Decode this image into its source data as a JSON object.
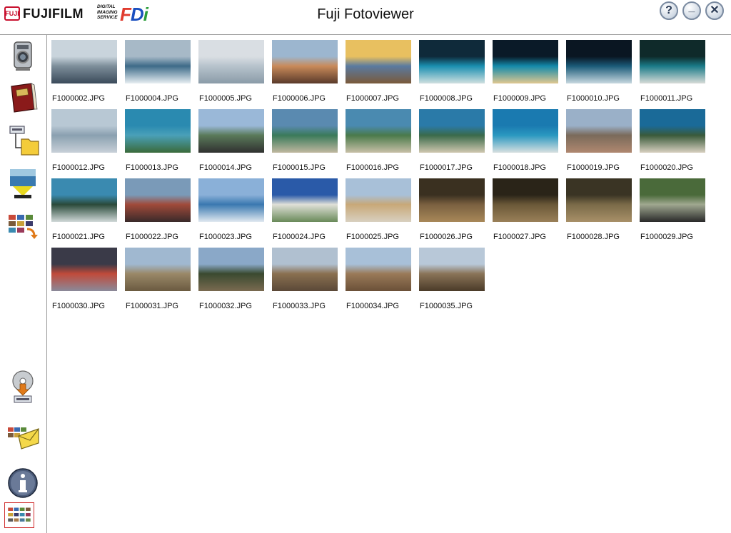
{
  "header": {
    "brand": "FUJIFILM",
    "brand_mark": "FUJI",
    "service_lines": [
      "DIGITAL",
      "IMAGING",
      "SERVICE"
    ],
    "service_logo": "FDi",
    "title": "Fuji Fotoviewer"
  },
  "window_buttons": {
    "help": "?",
    "minimize": "_",
    "close": "✕"
  },
  "sidebar": {
    "items": [
      {
        "name": "camera-icon"
      },
      {
        "name": "photo-album-icon"
      },
      {
        "name": "export-to-folder-icon"
      },
      {
        "name": "slideshow-projector-icon"
      },
      {
        "name": "rotate-images-icon"
      },
      {
        "name": "cd-download-icon"
      },
      {
        "name": "email-images-icon"
      },
      {
        "name": "info-icon"
      },
      {
        "name": "thumbnail-view-icon"
      }
    ]
  },
  "photos": [
    {
      "file": "F1000002.JPG",
      "colors": [
        "#c9d4dc",
        "#7d8e9a",
        "#3a4a5a"
      ]
    },
    {
      "file": "F1000004.JPG",
      "colors": [
        "#a7b9c7",
        "#3d6a88",
        "#e8eef2"
      ]
    },
    {
      "file": "F1000005.JPG",
      "colors": [
        "#d9dee3",
        "#b7c3cc",
        "#8a9ba8"
      ]
    },
    {
      "file": "F1000006.JPG",
      "colors": [
        "#9cb6cf",
        "#c98a5a",
        "#5a3a2a"
      ]
    },
    {
      "file": "F1000007.JPG",
      "colors": [
        "#e8c060",
        "#5a7aa0",
        "#7a5a3a"
      ]
    },
    {
      "file": "F1000008.JPG",
      "colors": [
        "#0f2a3a",
        "#1a8fb0",
        "#d0e0e0"
      ]
    },
    {
      "file": "F1000009.JPG",
      "colors": [
        "#0a1a28",
        "#138aaa",
        "#e0c890"
      ]
    },
    {
      "file": "F1000010.JPG",
      "colors": [
        "#0a1622",
        "#1a5a78",
        "#c8d8e0"
      ]
    },
    {
      "file": "F1000011.JPG",
      "colors": [
        "#0f2a2a",
        "#1a7a88",
        "#d8dcd8"
      ]
    },
    {
      "file": "F1000012.JPG",
      "colors": [
        "#b8c8d4",
        "#8aa0b0",
        "#c8d0d8"
      ]
    },
    {
      "file": "F1000013.JPG",
      "colors": [
        "#2a8ab0",
        "#4aa0b8",
        "#3a6a3a"
      ]
    },
    {
      "file": "F1000014.JPG",
      "colors": [
        "#9ab8d8",
        "#5a7a5a",
        "#303030"
      ]
    },
    {
      "file": "F1000015.JPG",
      "colors": [
        "#5a8ab0",
        "#3a7a5a",
        "#c0b8a0"
      ]
    },
    {
      "file": "F1000016.JPG",
      "colors": [
        "#4a8ab0",
        "#4a7a4a",
        "#c8c0a8"
      ]
    },
    {
      "file": "F1000017.JPG",
      "colors": [
        "#2a7aa8",
        "#3a6a4a",
        "#d0c8b0"
      ]
    },
    {
      "file": "F1000018.JPG",
      "colors": [
        "#1a7ab0",
        "#2a98c0",
        "#d8e0e0"
      ]
    },
    {
      "file": "F1000019.JPG",
      "colors": [
        "#9ab0c8",
        "#7a6a5a",
        "#b08870"
      ]
    },
    {
      "file": "F1000020.JPG",
      "colors": [
        "#1a6a98",
        "#3a5a3a",
        "#d8d0c0"
      ]
    },
    {
      "file": "F1000021.JPG",
      "colors": [
        "#3a8ab0",
        "#2a4a3a",
        "#d0d8d8"
      ]
    },
    {
      "file": "F1000022.JPG",
      "colors": [
        "#7a9ab8",
        "#a04a3a",
        "#3a2a2a"
      ]
    },
    {
      "file": "F1000023.JPG",
      "colors": [
        "#8ab0d8",
        "#3a78b0",
        "#e0e8f0"
      ]
    },
    {
      "file": "F1000024.JPG",
      "colors": [
        "#2a5aa8",
        "#e0e0d8",
        "#6a8a5a"
      ]
    },
    {
      "file": "F1000025.JPG",
      "colors": [
        "#a8c0d8",
        "#c8a878",
        "#d8d0c0"
      ]
    },
    {
      "file": "F1000026.JPG",
      "colors": [
        "#3a3020",
        "#7a6040",
        "#a88858"
      ]
    },
    {
      "file": "F1000027.JPG",
      "colors": [
        "#2a2418",
        "#6a5838",
        "#9a8058"
      ]
    },
    {
      "file": "F1000028.JPG",
      "colors": [
        "#3a3424",
        "#7a6a48",
        "#a89068"
      ]
    },
    {
      "file": "F1000029.JPG",
      "colors": [
        "#4a6a3a",
        "#a0a890",
        "#2a2a2a"
      ]
    },
    {
      "file": "F1000030.JPG",
      "colors": [
        "#3a3a48",
        "#c04a3a",
        "#8a8a9a"
      ]
    },
    {
      "file": "F1000031.JPG",
      "colors": [
        "#a0b8d0",
        "#9a8868",
        "#6a5a40"
      ]
    },
    {
      "file": "F1000032.JPG",
      "colors": [
        "#8aa8c8",
        "#3a4a30",
        "#7a6a50"
      ]
    },
    {
      "file": "F1000033.JPG",
      "colors": [
        "#b0c0d0",
        "#8a7050",
        "#5a4838"
      ]
    },
    {
      "file": "F1000034.JPG",
      "colors": [
        "#a8c0d8",
        "#9a7a58",
        "#6a5038"
      ]
    },
    {
      "file": "F1000035.JPG",
      "colors": [
        "#b8c8d8",
        "#8a7458",
        "#4a3a28"
      ]
    }
  ]
}
